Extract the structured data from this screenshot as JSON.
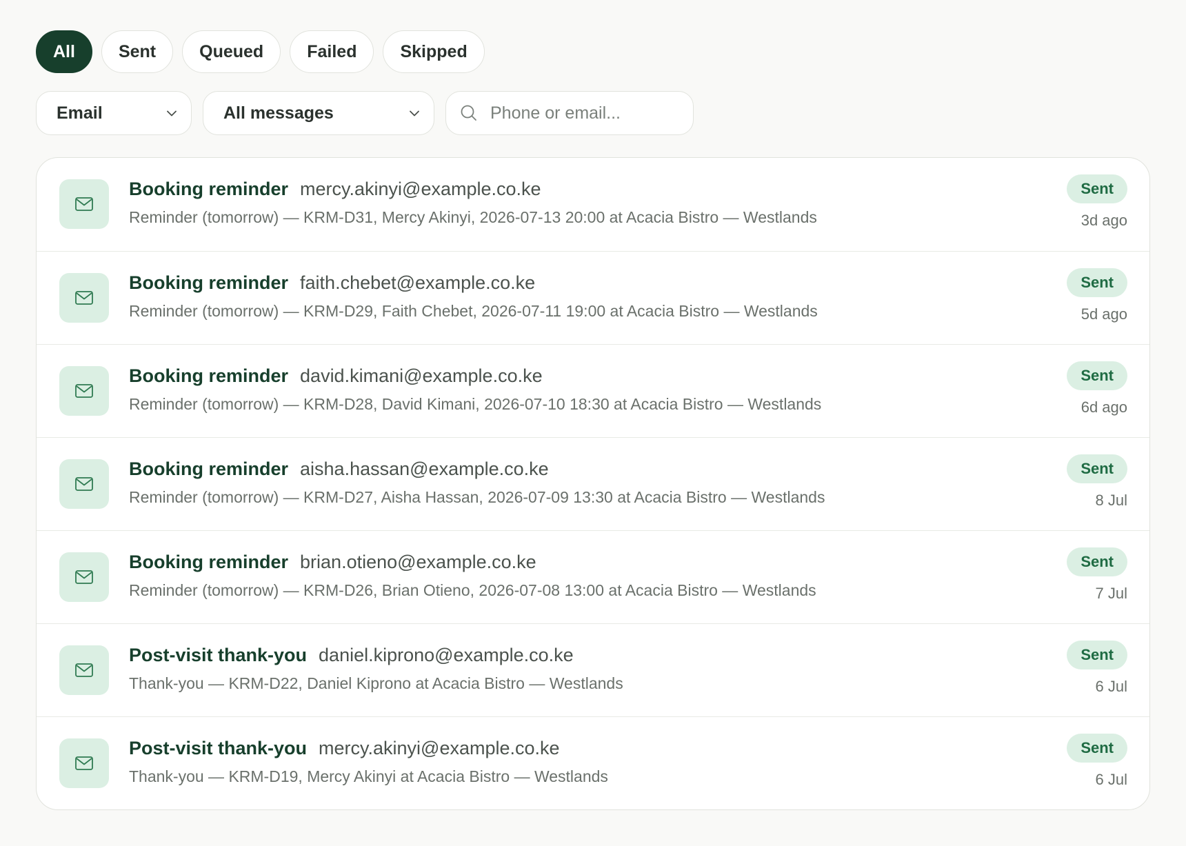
{
  "tabs": [
    {
      "label": "All",
      "active": true
    },
    {
      "label": "Sent",
      "active": false
    },
    {
      "label": "Queued",
      "active": false
    },
    {
      "label": "Failed",
      "active": false
    },
    {
      "label": "Skipped",
      "active": false
    }
  ],
  "filters": {
    "channel": {
      "value": "Email"
    },
    "message_type": {
      "value": "All messages"
    },
    "search": {
      "placeholder": "Phone or email...",
      "value": ""
    }
  },
  "messages": [
    {
      "title": "Booking reminder",
      "recipient": "mercy.akinyi@example.co.ke",
      "summary": "Reminder (tomorrow) — KRM-D31, Mercy Akinyi, 2026-07-13 20:00 at Acacia Bistro — Westlands",
      "status": "Sent",
      "time": "3d ago"
    },
    {
      "title": "Booking reminder",
      "recipient": "faith.chebet@example.co.ke",
      "summary": "Reminder (tomorrow) — KRM-D29, Faith Chebet, 2026-07-11 19:00 at Acacia Bistro — Westlands",
      "status": "Sent",
      "time": "5d ago"
    },
    {
      "title": "Booking reminder",
      "recipient": "david.kimani@example.co.ke",
      "summary": "Reminder (tomorrow) — KRM-D28, David Kimani, 2026-07-10 18:30 at Acacia Bistro — Westlands",
      "status": "Sent",
      "time": "6d ago"
    },
    {
      "title": "Booking reminder",
      "recipient": "aisha.hassan@example.co.ke",
      "summary": "Reminder (tomorrow) — KRM-D27, Aisha Hassan, 2026-07-09 13:30 at Acacia Bistro — Westlands",
      "status": "Sent",
      "time": "8 Jul"
    },
    {
      "title": "Booking reminder",
      "recipient": "brian.otieno@example.co.ke",
      "summary": "Reminder (tomorrow) — KRM-D26, Brian Otieno, 2026-07-08 13:00 at Acacia Bistro — Westlands",
      "status": "Sent",
      "time": "7 Jul"
    },
    {
      "title": "Post-visit thank-you",
      "recipient": "daniel.kiprono@example.co.ke",
      "summary": "Thank-you — KRM-D22, Daniel Kiprono at Acacia Bistro — Westlands",
      "status": "Sent",
      "time": "6 Jul"
    },
    {
      "title": "Post-visit thank-you",
      "recipient": "mercy.akinyi@example.co.ke",
      "summary": "Thank-you — KRM-D19, Mercy Akinyi at Acacia Bistro — Westlands",
      "status": "Sent",
      "time": "6 Jul"
    }
  ],
  "icons": {
    "row": "mail-icon",
    "search": "search-icon",
    "dropdown": "chevron-down-icon"
  },
  "colors": {
    "accent": "#173f2c",
    "badge_bg": "#dbefe3",
    "badge_text": "#1f6b43",
    "background": "#f9f9f7"
  }
}
